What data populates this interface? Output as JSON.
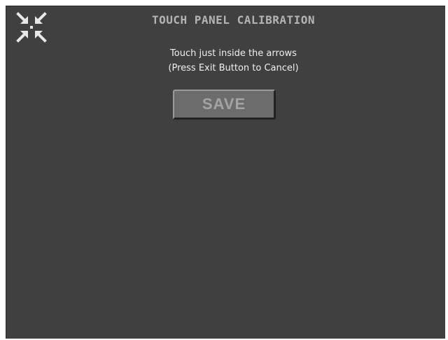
{
  "screen": {
    "title": "TOUCH PANEL CALIBRATION",
    "instructions": {
      "line1": "Touch just inside the arrows",
      "line2": "(Press Exit Button to Cancel)"
    },
    "save_button_label": "SAVE",
    "calibration_target_icon": "crosshair-arrows-icon"
  },
  "colors": {
    "background": "#404040",
    "title": "#b4b4b4",
    "text": "#f0f0f0",
    "button_face": "#6c6c6c",
    "button_label": "#a4a4a4"
  }
}
